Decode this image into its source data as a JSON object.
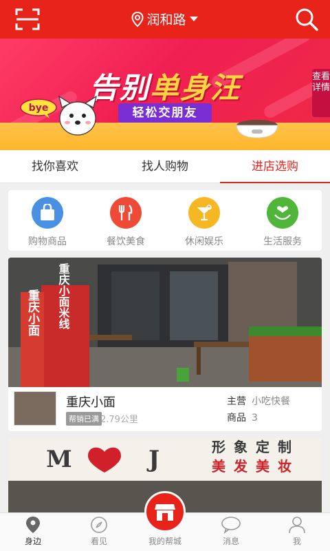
{
  "header": {
    "location": "润和路",
    "scan_icon": "scan-icon",
    "search_icon": "search-icon"
  },
  "banner": {
    "title_a": "告别",
    "title_b": "单身汪",
    "subtitle": "轻松交朋友",
    "detail": "查看详情",
    "bye": "bye"
  },
  "tabs": [
    {
      "label": "找你喜欢"
    },
    {
      "label": "找人购物"
    },
    {
      "label": "进店选购",
      "active": true
    }
  ],
  "categories": [
    {
      "label": "购物商品",
      "icon": "shopping-bag-icon",
      "color": "#4a90e2"
    },
    {
      "label": "餐饮美食",
      "icon": "fork-knife-icon",
      "color": "#ef4a36"
    },
    {
      "label": "休闲娱乐",
      "icon": "cocktail-icon",
      "color": "#f5b823"
    },
    {
      "label": "生活服务",
      "icon": "heart-hand-icon",
      "color": "#4fb63a"
    }
  ],
  "store": {
    "name": "重庆小面",
    "badge": "帮销已满",
    "distance": "2.79公里",
    "main_key": "主营",
    "main_val": "小吃快餐",
    "goods_key": "商品",
    "goods_val": "3",
    "sign": "重庆小面",
    "sign2": "重庆小面米线"
  },
  "store2": {
    "sign_left": "M",
    "sign_right": "J",
    "sign_top": "形象定制",
    "sign_bottom": "美发美妆"
  },
  "nav": [
    {
      "label": "身边",
      "icon": "location-pin-icon",
      "active": true
    },
    {
      "label": "看见",
      "icon": "compass-icon"
    },
    {
      "label": "我的帮城",
      "icon": "shop-icon"
    },
    {
      "label": "消息",
      "icon": "message-icon"
    },
    {
      "label": "我",
      "icon": "user-icon"
    }
  ],
  "colors": {
    "brand": "#e8231a",
    "badge": "#999999"
  }
}
